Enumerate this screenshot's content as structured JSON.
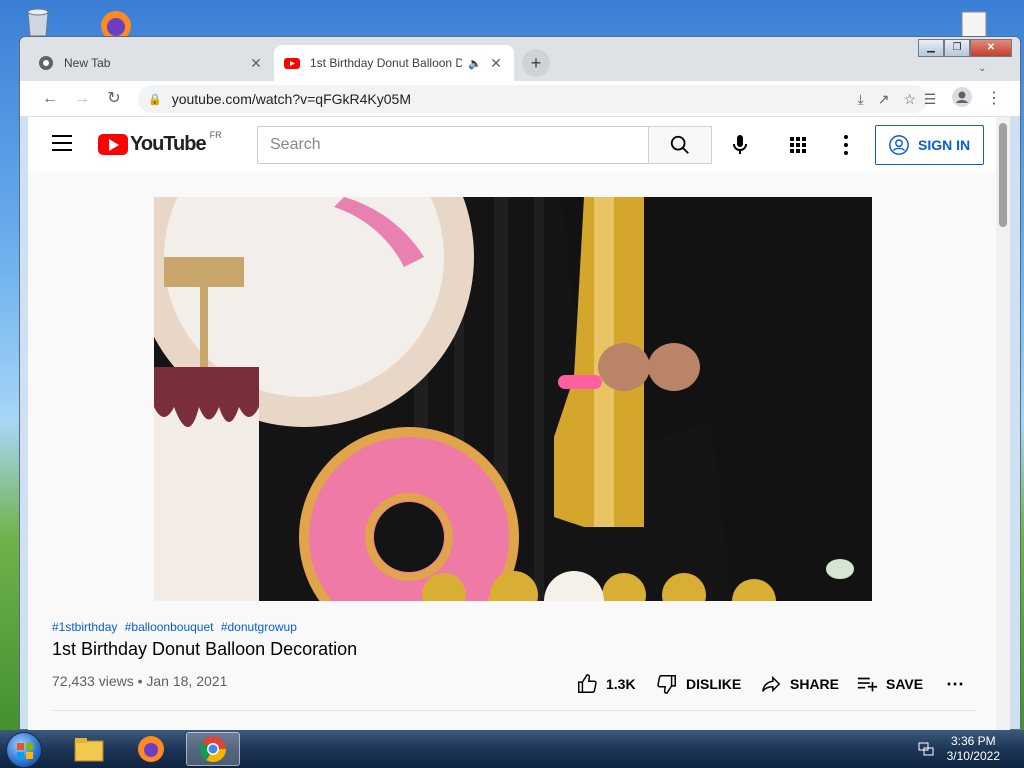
{
  "browser": {
    "tabs": [
      {
        "title": "New Tab",
        "active": false
      },
      {
        "title": "1st Birthday Donut Balloon D",
        "active": true
      }
    ],
    "url": "youtube.com/watch?v=qFGkR4Ky05M"
  },
  "youtube": {
    "logo_text": "YouTube",
    "region": "FR",
    "search_placeholder": "Search",
    "signin_label": "SIGN IN"
  },
  "video": {
    "hashtags": [
      "#1stbirthday",
      "#balloonbouquet",
      "#donutgrowup"
    ],
    "title": "1st Birthday Donut Balloon Decoration",
    "meta": "72,433 views • Jan 18, 2021",
    "likes": "1.3K",
    "dislike_label": "DISLIKE",
    "share_label": "SHARE",
    "save_label": "SAVE"
  },
  "taskbar": {
    "time": "3:36 PM",
    "date": "3/10/2022"
  },
  "colors": {
    "youtube_red": "#ff0000",
    "link_blue": "#065fd4"
  }
}
